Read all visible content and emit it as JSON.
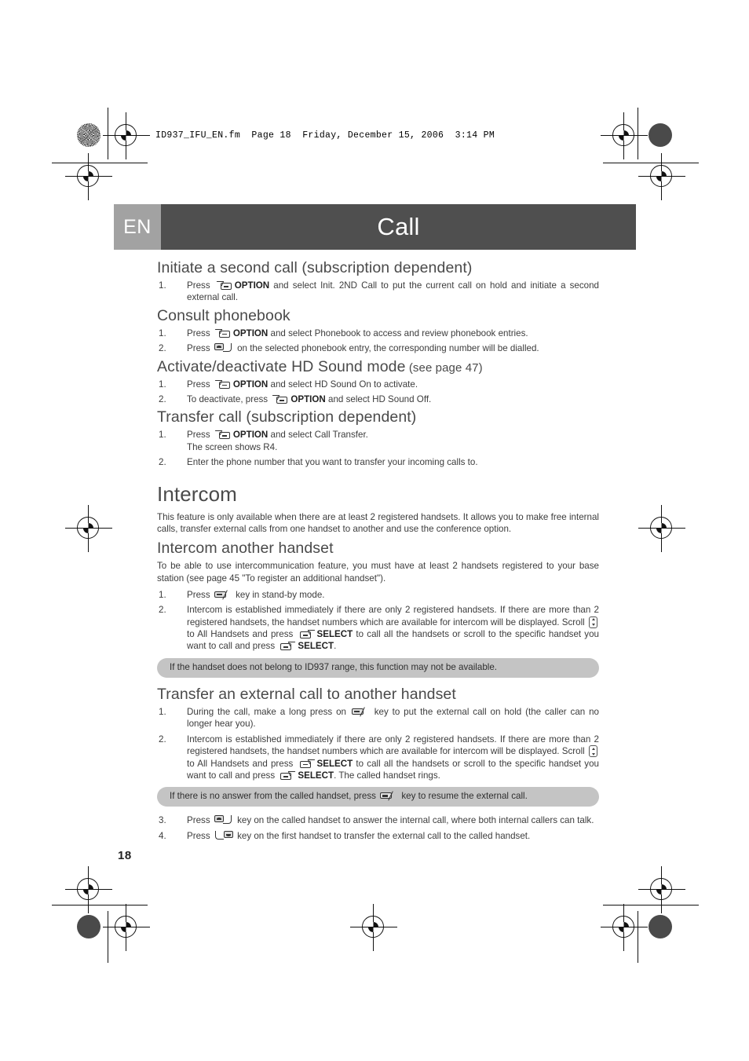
{
  "print_header": "ID937_IFU_EN.fm  Page 18  Friday, December 15, 2006  3:14 PM",
  "titlebar": {
    "language": "EN",
    "chapter": "Call"
  },
  "page_number": "18",
  "sections": [
    {
      "heading": "Initiate a second call (subscription dependent)",
      "heading_sub": "",
      "steps": [
        {
          "num": "1.",
          "parts": [
            {
              "t": "text",
              "v": "Press "
            },
            {
              "t": "icon",
              "v": "softkey-left-option"
            },
            {
              "t": "bold",
              "v": "OPTION"
            },
            {
              "t": "text",
              "v": " and select Init. 2ND Call to put the current call on hold and initiate a second external call."
            }
          ]
        }
      ]
    },
    {
      "heading": "Consult phonebook",
      "heading_sub": "",
      "steps": [
        {
          "num": "1.",
          "parts": [
            {
              "t": "text",
              "v": "Press "
            },
            {
              "t": "icon",
              "v": "softkey-left-option"
            },
            {
              "t": "bold",
              "v": "OPTION"
            },
            {
              "t": "text",
              "v": " and select Phonebook to access and review phonebook entries."
            }
          ]
        },
        {
          "num": "2.",
          "parts": [
            {
              "t": "text",
              "v": "Press "
            },
            {
              "t": "icon",
              "v": "talk-key"
            },
            {
              "t": "text",
              "v": " on the selected phonebook entry, the corresponding number will be dialled."
            }
          ]
        }
      ]
    },
    {
      "heading": "Activate/deactivate HD Sound mode",
      "heading_sub": "(see page 47)",
      "steps": [
        {
          "num": "1.",
          "parts": [
            {
              "t": "text",
              "v": "Press "
            },
            {
              "t": "icon",
              "v": "softkey-left-option"
            },
            {
              "t": "bold",
              "v": "OPTION"
            },
            {
              "t": "text",
              "v": " and select HD Sound On to activate."
            }
          ]
        },
        {
          "num": "2.",
          "parts": [
            {
              "t": "text",
              "v": "To deactivate, press "
            },
            {
              "t": "icon",
              "v": "softkey-left-option"
            },
            {
              "t": "bold",
              "v": "OPTION"
            },
            {
              "t": "text",
              "v": " and select HD Sound Off."
            }
          ]
        }
      ]
    },
    {
      "heading": "Transfer call (subscription dependent)",
      "heading_sub": "",
      "steps": [
        {
          "num": "1.",
          "parts": [
            {
              "t": "text",
              "v": "Press "
            },
            {
              "t": "icon",
              "v": "softkey-left-option"
            },
            {
              "t": "bold",
              "v": "OPTION"
            },
            {
              "t": "text",
              "v": " and select Call Transfer."
            },
            {
              "t": "break",
              "v": ""
            },
            {
              "t": "text",
              "v": "The screen shows R4."
            }
          ]
        },
        {
          "num": "2.",
          "parts": [
            {
              "t": "text",
              "v": "Enter the phone number that you want to transfer your incoming calls to."
            }
          ]
        }
      ]
    }
  ],
  "chapter_heading": "Intercom",
  "chapter_intro": "This feature is only available when there are at least 2 registered handsets. It allows you to make free internal calls, transfer external calls from one handset to another and use the conference option.",
  "subsections": [
    {
      "heading": "Intercom another handset",
      "intro": "To be able to use intercommunication feature, you must have at least 2 handsets registered to your base station (see page 45 \"To register an additional handset\").",
      "steps": [
        {
          "num": "1.",
          "parts": [
            {
              "t": "text",
              "v": "Press "
            },
            {
              "t": "icon",
              "v": "intercom-key"
            },
            {
              "t": "text",
              "v": " key in stand-by mode."
            }
          ]
        },
        {
          "num": "2.",
          "parts": [
            {
              "t": "text",
              "v": "Intercom is established immediately if there are only 2 registered handsets. If there are more than 2 registered handsets, the handset numbers which are available for intercom will be displayed. Scroll "
            },
            {
              "t": "icon",
              "v": "scroll-key"
            },
            {
              "t": "text",
              "v": " to All Handsets and press "
            },
            {
              "t": "icon",
              "v": "softkey-right-select"
            },
            {
              "t": "bold",
              "v": "SELECT"
            },
            {
              "t": "text",
              "v": " to call all the handsets or scroll to the specific handset you want to call and press "
            },
            {
              "t": "icon",
              "v": "softkey-right-select"
            },
            {
              "t": "bold",
              "v": "SELECT"
            },
            {
              "t": "text",
              "v": "."
            }
          ]
        }
      ],
      "note": [
        {
          "t": "text",
          "v": "If the handset does not belong to ID937 range, this function may not be available."
        }
      ]
    },
    {
      "heading": "Transfer an external call to another handset",
      "intro": "",
      "steps": [
        {
          "num": "1.",
          "parts": [
            {
              "t": "text",
              "v": "During the call, make a long press on "
            },
            {
              "t": "icon",
              "v": "intercom-key"
            },
            {
              "t": "text",
              "v": " key to put the external call on hold (the caller can no longer hear you)."
            }
          ]
        },
        {
          "num": "2.",
          "parts": [
            {
              "t": "text",
              "v": "Intercom is established immediately if there are only 2 registered handsets. If there are more than 2 registered handsets, the handset numbers which are available for intercom will be displayed. Scroll "
            },
            {
              "t": "icon",
              "v": "scroll-key"
            },
            {
              "t": "text",
              "v": " to All Handsets and press "
            },
            {
              "t": "icon",
              "v": "softkey-right-select"
            },
            {
              "t": "bold",
              "v": "SELECT"
            },
            {
              "t": "text",
              "v": " to call all the handsets or scroll to the specific handset you want to call and press "
            },
            {
              "t": "icon",
              "v": "softkey-right-select"
            },
            {
              "t": "bold",
              "v": "SELECT"
            },
            {
              "t": "text",
              "v": ". The called handset rings."
            }
          ]
        }
      ],
      "note": [
        {
          "t": "text",
          "v": "If there is no answer from the called handset, press "
        },
        {
          "t": "icon",
          "v": "intercom-key"
        },
        {
          "t": "text",
          "v": " key to resume the external call."
        }
      ],
      "steps_after_note": [
        {
          "num": "3.",
          "parts": [
            {
              "t": "text",
              "v": "Press "
            },
            {
              "t": "icon",
              "v": "talk-key"
            },
            {
              "t": "text",
              "v": " key on the called handset to answer the internal call, where both internal callers can talk."
            }
          ]
        },
        {
          "num": "4.",
          "parts": [
            {
              "t": "text",
              "v": "Press "
            },
            {
              "t": "icon",
              "v": "end-key"
            },
            {
              "t": "text",
              "v": " key on the first handset to transfer the external call to the called handset."
            }
          ]
        }
      ]
    }
  ],
  "colors": {
    "chapter_bar": "#4f4f4f",
    "lang_tab": "#a2a2a2",
    "note_bg": "#c4c4c4",
    "body_text": "#3c3c3c"
  }
}
